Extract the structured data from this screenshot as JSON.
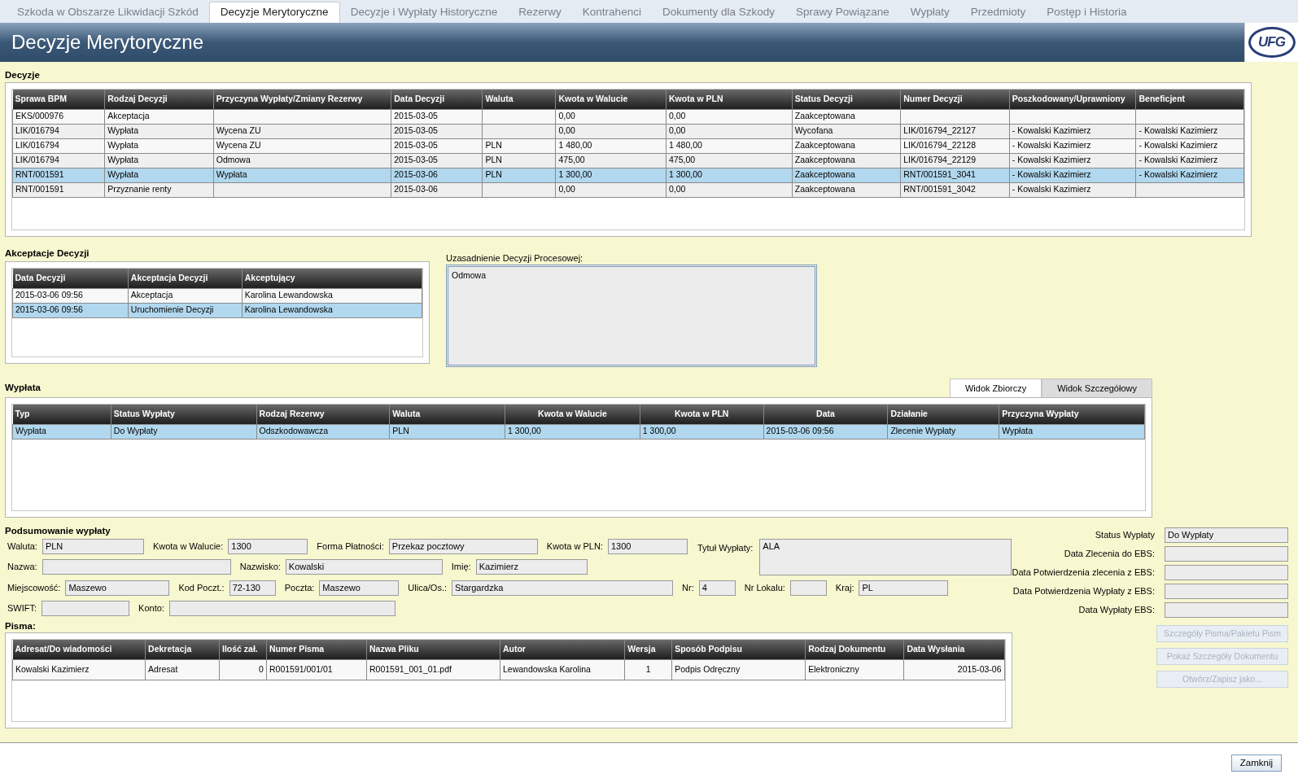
{
  "tabs": [
    {
      "label": "Szkoda w Obszarze Likwidacji Szkód",
      "selected": false
    },
    {
      "label": "Decyzje Merytoryczne",
      "selected": true
    },
    {
      "label": "Decyzje i Wypłaty Historyczne",
      "selected": false
    },
    {
      "label": "Rezerwy",
      "selected": false
    },
    {
      "label": "Kontrahenci",
      "selected": false
    },
    {
      "label": "Dokumenty dla Szkody",
      "selected": false
    },
    {
      "label": "Sprawy Powiązane",
      "selected": false
    },
    {
      "label": "Wypłaty",
      "selected": false
    },
    {
      "label": "Przedmioty",
      "selected": false
    },
    {
      "label": "Postęp i Historia",
      "selected": false
    }
  ],
  "header": {
    "title": "Decyzje Merytoryczne",
    "logo": "UFG"
  },
  "decisions": {
    "title": "Decyzje",
    "columns": [
      "Sprawa BPM",
      "Rodzaj Decyzji",
      "Przyczyna Wypłaty/Zmiany Rezerwy",
      "Data Decyzji",
      "Waluta",
      "Kwota w Walucie",
      "Kwota w PLN",
      "Status Decyzji",
      "Numer Decyzji",
      "Poszkodowany/Uprawniony",
      "Beneficjent"
    ],
    "rows": [
      {
        "selected": false,
        "cells": [
          "EKS/000976",
          "Akceptacja",
          null,
          "2015-03-05",
          null,
          "0,00",
          "0,00",
          "Zaakceptowana",
          null,
          null,
          null
        ]
      },
      {
        "selected": false,
        "cells": [
          "LIK/016794",
          "Wypłata",
          "Wycena ZU",
          "2015-03-05",
          null,
          "0,00",
          "0,00",
          "Wycofana",
          "LIK/016794_22127",
          "- Kowalski Kazimierz",
          "- Kowalski Kazimierz"
        ]
      },
      {
        "selected": false,
        "cells": [
          "LIK/016794",
          "Wypłata",
          "Wycena ZU",
          "2015-03-05",
          "PLN",
          "1 480,00",
          "1 480,00",
          "Zaakceptowana",
          "LIK/016794_22128",
          "- Kowalski Kazimierz",
          "- Kowalski Kazimierz"
        ]
      },
      {
        "selected": false,
        "cells": [
          "LIK/016794",
          "Wypłata",
          "Odmowa",
          "2015-03-05",
          "PLN",
          "475,00",
          "475,00",
          "Zaakceptowana",
          "LIK/016794_22129",
          "- Kowalski Kazimierz",
          "- Kowalski Kazimierz"
        ]
      },
      {
        "selected": true,
        "cells": [
          "RNT/001591",
          "Wypłata",
          "Wypłata",
          "2015-03-06",
          "PLN",
          "1 300,00",
          "1 300,00",
          "Zaakceptowana",
          "RNT/001591_3041",
          "- Kowalski Kazimierz",
          "- Kowalski Kazimierz"
        ]
      },
      {
        "selected": false,
        "cells": [
          "RNT/001591",
          "Przyznanie renty",
          null,
          "2015-03-06",
          null,
          "0,00",
          "0,00",
          "Zaakceptowana",
          "RNT/001591_3042",
          "- Kowalski Kazimierz",
          null
        ]
      }
    ]
  },
  "acceptances": {
    "title": "Akceptacje Decyzji",
    "columns": [
      "Data Decyzji",
      "Akceptacja Decyzji",
      "Akceptujący"
    ],
    "rows": [
      {
        "selected": false,
        "cells": [
          "2015-03-06 09:56",
          "Akceptacja",
          "Karolina Lewandowska"
        ]
      },
      {
        "selected": true,
        "cells": [
          "2015-03-06 09:56",
          "Uruchomienie Decyzji",
          "Karolina Lewandowska"
        ]
      }
    ]
  },
  "justification": {
    "label": "Uzasadnienie Decyzji Procesowej:",
    "value": "Odmowa"
  },
  "payout": {
    "title": "Wypłata",
    "view_tabs": [
      {
        "label": "Widok Zbiorczy",
        "selected": true
      },
      {
        "label": "Widok Szczegółowy",
        "selected": false
      }
    ],
    "columns": [
      "Typ",
      "Status Wypłaty",
      "Rodzaj Rezerwy",
      "Waluta",
      "Kwota w Walucie",
      "Kwota w PLN",
      "Data",
      "Działanie",
      "Przyczyna Wypłaty"
    ],
    "rows": [
      {
        "selected": true,
        "cells": [
          "Wypłata",
          "Do Wypłaty",
          "Odszkodowawcza",
          "PLN",
          "1 300,00",
          "1 300,00",
          "2015-03-06 09:56",
          "Zlecenie Wypłaty",
          "Wypłata"
        ]
      }
    ]
  },
  "summary": {
    "title": "Podsumowanie wypłaty",
    "rows": [
      [
        {
          "label": "Waluta:",
          "value": "PLN"
        },
        {
          "label": "Kwota w Walucie:",
          "value": "1300"
        },
        {
          "label": "Forma Płatności:",
          "value": "Przekaz pocztowy"
        },
        {
          "label": "Kwota w PLN:",
          "value": "1300"
        }
      ],
      [
        {
          "label": "Nazwa:"
        },
        {
          "label": "Nazwisko:",
          "value": "Kowalski"
        },
        {
          "label": "Imię:",
          "value": "Kazimierz"
        }
      ],
      [
        {
          "label": "Miejscowość:",
          "value": "Maszewo"
        },
        {
          "label": "Kod Poczt.:",
          "value": "72-130"
        },
        {
          "label": "Poczta:",
          "value": "Maszewo"
        },
        {
          "label": "Ulica/Os.:",
          "value": "Stargardzka"
        },
        {
          "label": "Nr:",
          "value": "4"
        },
        {
          "label": "Nr Lokalu:"
        },
        {
          "label": "Kraj:",
          "value": "PL"
        }
      ],
      [
        {
          "label": "SWIFT:"
        },
        {
          "label": "Konto:"
        }
      ]
    ],
    "title_field": {
      "label": "Tytuł Wypłaty:",
      "value": "ALA"
    },
    "status_fields": [
      {
        "label": "Status Wypłaty",
        "value": "Do Wypłaty"
      },
      {
        "label": "Data Zlecenia do EBS:"
      },
      {
        "label": "Data Potwierdzenia zlecenia z EBS:"
      },
      {
        "label": "Data Potwierdzenia Wypłaty z EBS:"
      },
      {
        "label": "Data Wypłaty EBS:"
      }
    ]
  },
  "letters": {
    "title": "Pisma:",
    "columns": [
      "Adresat/Do wiadomości",
      "Dekretacja",
      "Ilość zał.",
      "Numer Pisma",
      "Nazwa Pliku",
      "Autor",
      "Wersja",
      "Sposób Podpisu",
      "Rodzaj Dokumentu",
      "Data Wysłania"
    ],
    "rows": [
      {
        "selected": false,
        "cells": [
          "Kowalski Kazimierz",
          "Adresat",
          "0",
          "R001591/001/01",
          "R001591_001_01.pdf",
          "Lewandowska Karolina",
          "1",
          "Podpis Odręczny",
          "Elektroniczny",
          "2015-03-06"
        ]
      }
    ],
    "buttons": [
      {
        "label": "Szczegóły Pisma/Pakietu Pism",
        "disabled": true
      },
      {
        "label": "Pokaż Szczegóły Dokumentu",
        "disabled": true
      },
      {
        "label": "Otwórz/Zapisz jako...",
        "disabled": true
      }
    ]
  },
  "footer": {
    "buttons": [
      {
        "label": "Zamknij",
        "disabled": false
      }
    ]
  }
}
